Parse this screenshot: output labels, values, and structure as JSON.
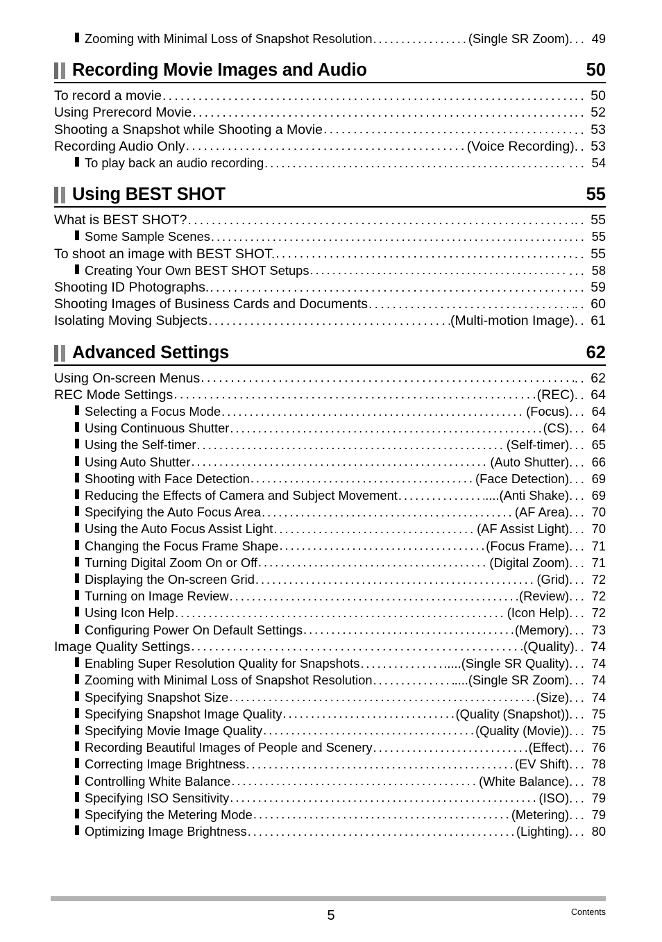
{
  "document": {
    "footer": {
      "page_number": "5",
      "label": "Contents"
    }
  },
  "toc": {
    "orphan_entries": [
      {
        "level": "sub",
        "label": "Zooming with Minimal Loss of Snapshot Resolution",
        "leader": "....",
        "tail": "(Single SR Zoom)",
        "predots": "...",
        "page": "49"
      }
    ],
    "sections": [
      {
        "title": "Recording Movie Images and Audio",
        "page": "50",
        "entries": [
          {
            "level": "main",
            "label": "To record a movie",
            "tail": "",
            "predots": "..",
            "page": "50"
          },
          {
            "level": "main",
            "label": "Using Prerecord Movie",
            "tail": "",
            "predots": "..",
            "page": "52"
          },
          {
            "level": "main",
            "label": "Shooting a Snapshot while Shooting a Movie",
            "tail": "",
            "predots": "..",
            "page": "53"
          },
          {
            "level": "main",
            "label": "Recording Audio Only",
            "tail": "(Voice Recording)",
            "predots": "..",
            "page": "53"
          },
          {
            "level": "sub",
            "label": "To play back an audio recording",
            "tail": "",
            "predots": "...",
            "page": "54"
          }
        ]
      },
      {
        "title": "Using BEST SHOT",
        "page": "55",
        "entries": [
          {
            "level": "main",
            "label": "What is BEST SHOT?",
            "tail": "",
            "predots": "..",
            "page": "55"
          },
          {
            "level": "sub",
            "label": "Some Sample Scenes",
            "tail": "",
            "predots": "...",
            "page": "55"
          },
          {
            "level": "main",
            "label": "To shoot an image with BEST SHOT.",
            "tail": "",
            "predots": "..",
            "page": "55"
          },
          {
            "level": "sub",
            "label": "Creating Your Own BEST SHOT Setups",
            "tail": "",
            "predots": "...",
            "page": "58"
          },
          {
            "level": "main",
            "label": "Shooting ID Photographs.",
            "tail": "",
            "predots": "..",
            "page": "59"
          },
          {
            "level": "main",
            "label": "Shooting Images of Business Cards and Documents",
            "tail": "",
            "predots": "..",
            "page": "60"
          },
          {
            "level": "main",
            "label": "Isolating Moving Subjects",
            "tail": "(Multi-motion Image)",
            "predots": "..",
            "page": "61"
          }
        ]
      },
      {
        "title": "Advanced Settings",
        "page": "62",
        "entries": [
          {
            "level": "main",
            "label": "Using On-screen Menus",
            "tail": "",
            "predots": "..",
            "page": "62"
          },
          {
            "level": "main",
            "label": "REC Mode Settings",
            "tail": "(REC)",
            "predots": "..",
            "page": "64"
          },
          {
            "level": "sub",
            "label": "Selecting a Focus Mode",
            "tail": "(Focus)",
            "predots": "...",
            "page": "64"
          },
          {
            "level": "sub",
            "label": "Using Continuous Shutter",
            "tail": "(CS)",
            "predots": "...",
            "page": "64"
          },
          {
            "level": "sub",
            "label": "Using the Self-timer",
            "tail": "(Self-timer)",
            "predots": "...",
            "page": "65"
          },
          {
            "level": "sub",
            "label": "Using Auto Shutter",
            "tail": "(Auto Shutter)",
            "predots": "...",
            "page": "66"
          },
          {
            "level": "sub",
            "label": "Shooting with Face Detection",
            "tail": "(Face Detection)",
            "predots": "...",
            "page": "69"
          },
          {
            "level": "sub",
            "label": "Reducing the Effects of Camera and Subject Movement",
            "tail": "....(Anti Shake)",
            "predots": "...",
            "page": "69"
          },
          {
            "level": "sub",
            "label": "Specifying the Auto Focus Area",
            "tail": "(AF Area)",
            "predots": "...",
            "page": "70"
          },
          {
            "level": "sub",
            "label": "Using the Auto Focus Assist Light",
            "tail": "(AF Assist Light)",
            "predots": "...",
            "page": "70"
          },
          {
            "level": "sub",
            "label": "Changing the Focus Frame Shape",
            "tail": "(Focus Frame)",
            "predots": "...",
            "page": "71"
          },
          {
            "level": "sub",
            "label": "Turning Digital Zoom On or Off",
            "tail": "(Digital Zoom)",
            "predots": "...",
            "page": "71"
          },
          {
            "level": "sub",
            "label": "Displaying the On-screen Grid",
            "tail": "(Grid)",
            "predots": "...",
            "page": "72"
          },
          {
            "level": "sub",
            "label": "Turning on Image Review",
            "tail": "(Review)",
            "predots": "...",
            "page": "72"
          },
          {
            "level": "sub",
            "label": "Using Icon Help",
            "tail": "(Icon Help)",
            "predots": "...",
            "page": "72"
          },
          {
            "level": "sub",
            "label": "Configuring Power On Default Settings",
            "tail": "(Memory)",
            "predots": "...",
            "page": "73"
          },
          {
            "level": "main",
            "label": "Image Quality Settings",
            "tail": "(Quality)",
            "predots": "..",
            "page": "74"
          },
          {
            "level": "sub",
            "label": "Enabling Super Resolution Quality for Snapshots",
            "tail": ".....(Single SR Quality)",
            "predots": "...",
            "page": "74"
          },
          {
            "level": "sub",
            "label": "Zooming with Minimal Loss of Snapshot Resolution",
            "tail": "....(Single SR Zoom)",
            "predots": "...",
            "page": "74"
          },
          {
            "level": "sub",
            "label": "Specifying Snapshot Size",
            "tail": "(Size)",
            "predots": "...",
            "page": "74"
          },
          {
            "level": "sub",
            "label": "Specifying Snapshot Image Quality",
            "tail": "(Quality (Snapshot))",
            "predots": "...",
            "page": "75"
          },
          {
            "level": "sub",
            "label": "Specifying Movie Image Quality",
            "tail": "(Quality (Movie))",
            "predots": "...",
            "page": "75"
          },
          {
            "level": "sub",
            "label": "Recording Beautiful Images of People and Scenery",
            "tail": "(Effect)",
            "predots": "...",
            "page": "76"
          },
          {
            "level": "sub",
            "label": "Correcting Image Brightness",
            "tail": "(EV Shift)",
            "predots": "...",
            "page": "78"
          },
          {
            "level": "sub",
            "label": "Controlling White Balance",
            "tail": "(White Balance)",
            "predots": "...",
            "page": "78"
          },
          {
            "level": "sub",
            "label": "Specifying ISO Sensitivity",
            "tail": "(ISO)",
            "predots": "...",
            "page": "79"
          },
          {
            "level": "sub",
            "label": "Specifying the Metering Mode",
            "tail": "(Metering)",
            "predots": "...",
            "page": "79"
          },
          {
            "level": "sub",
            "label": "Optimizing Image Brightness",
            "tail": "(Lighting)",
            "predots": "...",
            "page": "80"
          }
        ]
      }
    ]
  }
}
